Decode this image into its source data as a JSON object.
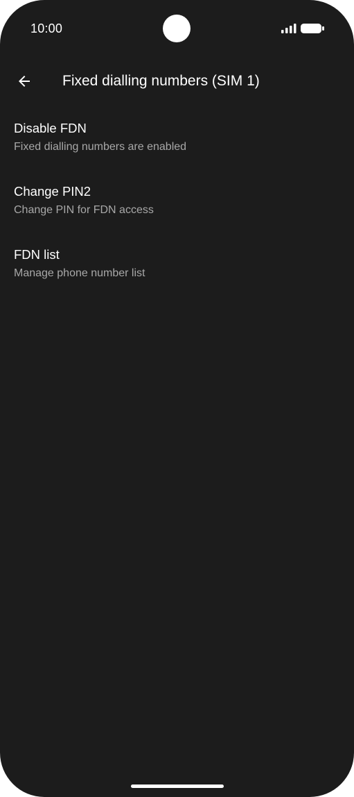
{
  "status_bar": {
    "time": "10:00",
    "signal_icon": "signal-bars-icon",
    "battery_icon": "battery-full-icon"
  },
  "app_bar": {
    "back_icon": "arrow-back-icon",
    "title": "Fixed dialling numbers (SIM 1)"
  },
  "preferences": [
    {
      "title": "Disable FDN",
      "summary": "Fixed dialling numbers are enabled"
    },
    {
      "title": "Change PIN2",
      "summary": "Change PIN for FDN access"
    },
    {
      "title": "FDN list",
      "summary": "Manage phone number list"
    }
  ],
  "colors": {
    "background": "#1c1c1c",
    "text_primary": "#ffffff",
    "text_secondary": "#a8a8a8"
  }
}
